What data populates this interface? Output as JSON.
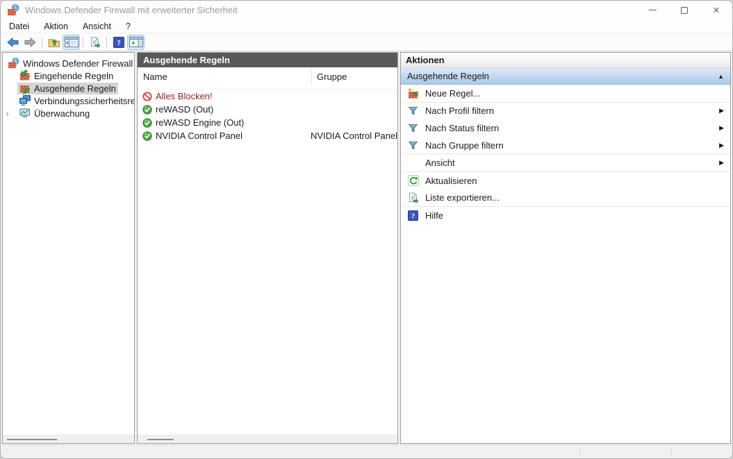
{
  "window": {
    "title": "Windows Defender Firewall mit erweiterter Sicherheit",
    "controls": {
      "close": "×"
    }
  },
  "menubar": {
    "items": [
      "Datei",
      "Aktion",
      "Ansicht",
      "?"
    ]
  },
  "toolbar": {
    "buttons": [
      "back",
      "forward",
      "up-level",
      "console-tree-toggle",
      "export-list",
      "help",
      "action-pane-toggle"
    ],
    "active_buttons": [
      "console-tree-toggle",
      "action-pane-toggle"
    ]
  },
  "tree": {
    "root_label": "Windows Defender Firewall mit",
    "chevron_glyph": "›",
    "items": [
      {
        "label": "Eingehende Regeln",
        "selected": false
      },
      {
        "label": "Ausgehende Regeln",
        "selected": true
      },
      {
        "label": "Verbindungssicherheitsrege",
        "selected": false
      },
      {
        "label": "Überwachung",
        "selected": false,
        "expandable": true
      }
    ]
  },
  "list": {
    "title": "Ausgehende Regeln",
    "columns": {
      "name": "Name",
      "group": "Gruppe"
    },
    "rows": [
      {
        "name": "Alles Blocken!",
        "group": "",
        "status": "blocked"
      },
      {
        "name": "reWASD (Out)",
        "group": "",
        "status": "allowed"
      },
      {
        "name": "reWASD Engine (Out)",
        "group": "",
        "status": "allowed"
      },
      {
        "name": "NVIDIA Control Panel",
        "group": "NVIDIA Control Panel",
        "status": "allowed"
      }
    ]
  },
  "actions": {
    "title": "Aktionen",
    "section_label": "Ausgehende Regeln",
    "collapse_glyph": "▲",
    "submenu_glyph": "▶",
    "items": [
      {
        "label": "Neue Regel...",
        "icon": "new-rule",
        "submenu": false
      },
      {
        "label": "Nach Profil filtern",
        "icon": "filter",
        "submenu": true
      },
      {
        "label": "Nach Status filtern",
        "icon": "filter",
        "submenu": true
      },
      {
        "label": "Nach Gruppe filtern",
        "icon": "filter",
        "submenu": true
      },
      {
        "label": "Ansicht",
        "icon": "none",
        "submenu": true
      },
      {
        "label": "Aktualisieren",
        "icon": "refresh",
        "submenu": false
      },
      {
        "label": "Liste exportieren...",
        "icon": "export-list",
        "submenu": false
      },
      {
        "label": "Hilfe",
        "icon": "help",
        "submenu": false
      }
    ]
  },
  "colors": {
    "list_header_bg": "#595959",
    "section_header_top": "#dcebf9",
    "section_header_bottom": "#abc8e8",
    "allowed_green": "#47a83c",
    "blocked_red": "#d23a3a",
    "blocked_text": "#9a1f1f",
    "tree_selected_bg": "#d4d4d4",
    "toolbar_active_bg": "#dbe9f7"
  }
}
